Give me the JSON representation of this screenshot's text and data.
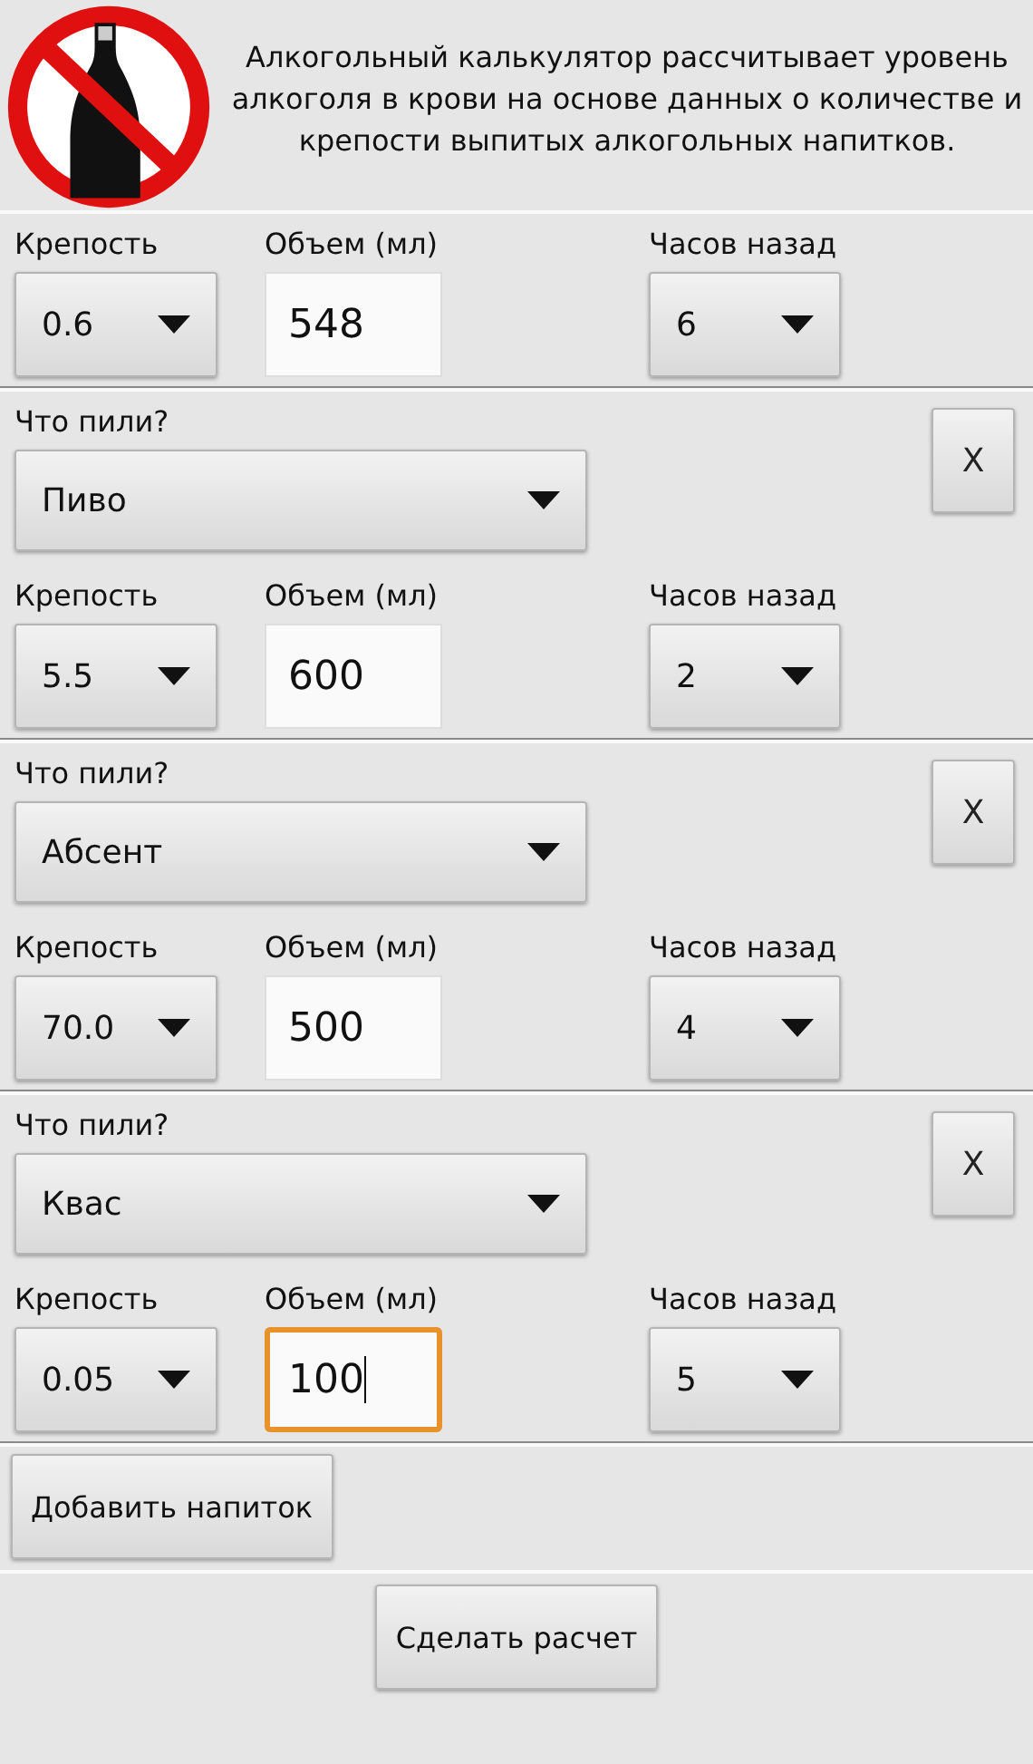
{
  "header": {
    "text": "Алкогольный калькулятор рассчитывает уровень алкоголя в крови на основе данных о количестве и крепости выпитых алкогольных напитков."
  },
  "entries": [
    {
      "strength": {
        "label": "Крепость",
        "value": "0.6"
      },
      "volume": {
        "label": "Объем (мл)",
        "value": "548",
        "focused": false
      },
      "hours": {
        "label": "Часов назад",
        "value": "6"
      }
    },
    {
      "drink": {
        "label": "Что пили?",
        "value": "Пиво"
      },
      "remove": "X",
      "strength": {
        "label": "Крепость",
        "value": "5.5"
      },
      "volume": {
        "label": "Объем (мл)",
        "value": "600",
        "focused": false
      },
      "hours": {
        "label": "Часов назад",
        "value": "2"
      }
    },
    {
      "drink": {
        "label": "Что пили?",
        "value": "Абсент"
      },
      "remove": "X",
      "strength": {
        "label": "Крепость",
        "value": "70.0"
      },
      "volume": {
        "label": "Объем (мл)",
        "value": "500",
        "focused": false
      },
      "hours": {
        "label": "Часов назад",
        "value": "4"
      }
    },
    {
      "drink": {
        "label": "Что пили?",
        "value": "Квас"
      },
      "remove": "X",
      "strength": {
        "label": "Крепость",
        "value": "0.05"
      },
      "volume": {
        "label": "Объем (мл)",
        "value": "100",
        "focused": true
      },
      "hours": {
        "label": "Часов назад",
        "value": "5"
      }
    }
  ],
  "add_button": "Добавить напиток",
  "calc_button": "Сделать расчет"
}
